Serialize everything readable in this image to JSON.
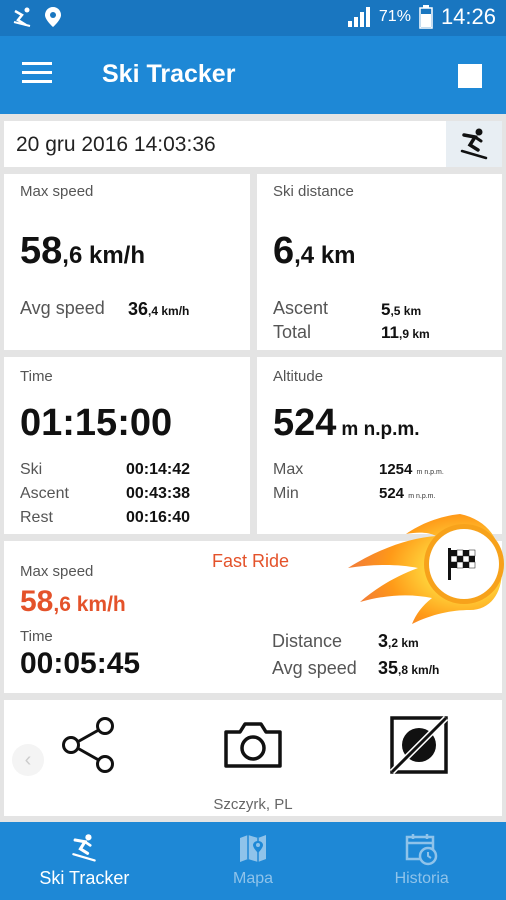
{
  "status_bar": {
    "battery_percent": "71%",
    "time": "14:26",
    "icons": [
      "ski-notification-icon",
      "location-pin-icon",
      "signal-icon",
      "battery-icon"
    ]
  },
  "app_bar": {
    "title": "Ski Tracker",
    "icons": [
      "hamburger-menu-icon",
      "stop-icon"
    ]
  },
  "session": {
    "datetime": "20 gru 2016 14:03:36",
    "mode_icon": "skier-icon"
  },
  "speed_card": {
    "label": "Max speed",
    "max_int": "58",
    "max_dec": ",6 km/h",
    "avg_label": "Avg speed",
    "avg_int": "36",
    "avg_dec": ",4 km/h"
  },
  "distance_card": {
    "label": "Ski distance",
    "dist_int": "6",
    "dist_dec": ",4 km",
    "ascent_label": "Ascent",
    "ascent_int": "5",
    "ascent_dec": ",5 km",
    "total_label": "Total",
    "total_int": "11",
    "total_dec": ",9 km"
  },
  "time_card": {
    "label": "Time",
    "value": "01:15:00",
    "rows": [
      {
        "label": "Ski",
        "value": "00:14:42"
      },
      {
        "label": "Ascent",
        "value": "00:43:38"
      },
      {
        "label": "Rest",
        "value": "00:16:40"
      }
    ]
  },
  "altitude_card": {
    "label": "Altitude",
    "value": "524",
    "unit": "m n.p.m.",
    "max_label": "Max",
    "max_value": "1254",
    "min_label": "Min",
    "min_value": "524",
    "small_unit": "m n.p.m."
  },
  "fast_ride": {
    "title": "Fast Ride",
    "max_label": "Max speed",
    "max_int": "58",
    "max_dec": ",6 km/h",
    "time_label": "Time",
    "time_value": "00:05:45",
    "distance_label": "Distance",
    "distance_int": "3",
    "distance_dec": ",2 km",
    "avg_label": "Avg speed",
    "avg_int": "35",
    "avg_dec": ",8 km/h",
    "badge_icon": "checkered-flag-icon",
    "accent_color": "#e4522a"
  },
  "actions": {
    "location": "Szczyrk, PL",
    "icons": [
      "share-icon",
      "camera-icon",
      "no-photo-icon",
      "chevron-left-icon"
    ]
  },
  "bottom_nav": [
    {
      "label": "Ski Tracker",
      "icon": "skier-icon",
      "active": true
    },
    {
      "label": "Mapa",
      "icon": "map-icon",
      "active": false
    },
    {
      "label": "Historia",
      "icon": "calendar-history-icon",
      "active": false
    }
  ],
  "colors": {
    "primary": "#1e88d6",
    "primary_dark": "#1976c0",
    "accent": "#e4522a",
    "background": "#e4e4e4"
  }
}
